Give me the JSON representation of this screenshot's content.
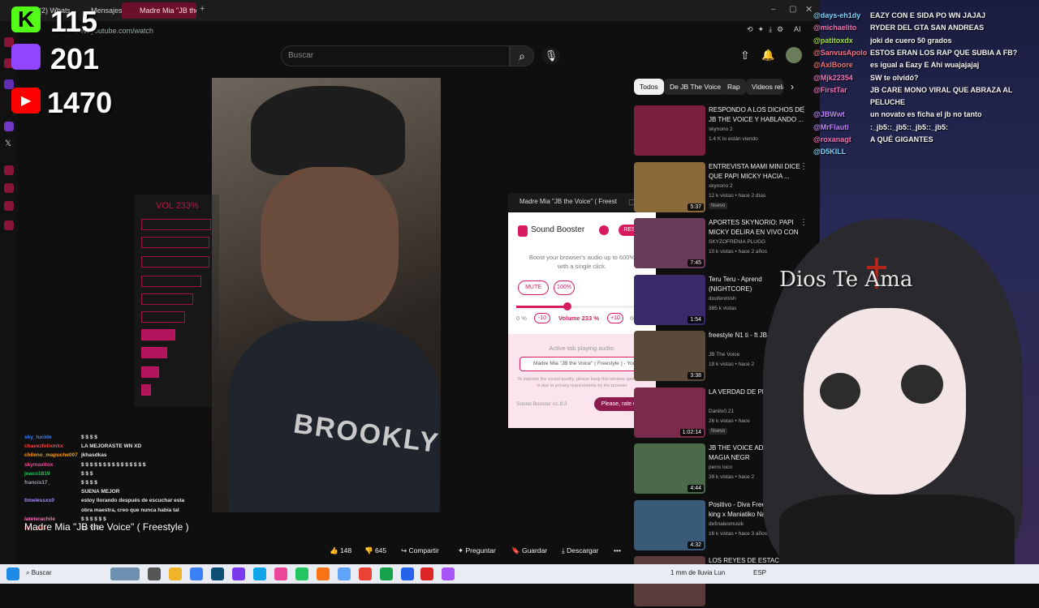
{
  "browser": {
    "tabs": [
      {
        "label": "(2) Whatsapp",
        "active": false
      },
      {
        "label": "Mensajes",
        "active": false
      },
      {
        "label": "Madre Mia \"JB the Voice\"",
        "active": true
      }
    ],
    "new_tab": "+",
    "url": "www.youtube.com/watch"
  },
  "overlay": {
    "kick_count": "115",
    "twitch_count": "201",
    "youtube_count": "1470",
    "volume_label": "VOL 233%",
    "volume_fraction": 0.4
  },
  "youtube": {
    "search_placeholder": "Buscar",
    "video_title": "Madre Mia \"JB the Voice\" ( Freestyle )",
    "video_shirt_text": "BROOKLY",
    "actions": {
      "likes": "148",
      "dislikes": "645",
      "share": "Compartir",
      "ask": "Preguntar",
      "save": "Guardar",
      "download": "Descargar"
    },
    "chips": [
      "Todos",
      "De JB The Voice",
      "Rap",
      "Videos rela"
    ],
    "recommendations": [
      {
        "title": "RESPONDO A LOS DICHOS DE JB THE VOICE Y HABLANDO ...",
        "channel": "skynorio 2",
        "meta": "1.4 K lo están viendo",
        "duration": "",
        "badge": "",
        "thumb": "#7a1f3d"
      },
      {
        "title": "ENTREVISTA MAMI MINI DICE QUE PAPI MICKY HACIA ...",
        "channel": "skynorio 2",
        "meta": "12 k vistas • hace 2 días",
        "duration": "5:37",
        "badge": "Nuevo",
        "thumb": "#8a6a3a"
      },
      {
        "title": "APORTES SKYNORIO: PAPI MICKY DELIRA EN VIVO CON",
        "channel": "SKYZOFRENIA PLUGG",
        "meta": "10 k vistas • hace 2 años",
        "duration": "7:45",
        "badge": "",
        "thumb": "#6a3a5a"
      },
      {
        "title": "Teru Teru - Aprend (NIGHTCORE)",
        "channel": "doofenmish",
        "meta": "385 k vistas",
        "duration": "1:54",
        "badge": "",
        "thumb": "#3a2a6a"
      },
      {
        "title": "freestyle N1 ti - ft JB the",
        "channel": "JB The Voice",
        "meta": "19 k vistas • hace 2",
        "duration": "3:38",
        "badge": "",
        "thumb": "#5a4a3a"
      },
      {
        "title": "LA VERDAD DE PLAYBOY",
        "channel": "Danilo0.21",
        "meta": "26 k vistas • hace",
        "duration": "1:02:14",
        "badge": "Nuevo",
        "thumb": "#7a2a4a"
      },
      {
        "title": "JB THE VOICE ADM HACIA MAGIA NEGR",
        "channel": "perro loco",
        "meta": "39 k vistas • hace 2",
        "duration": "4:44",
        "badge": "",
        "thumb": "#4a6a4a"
      },
      {
        "title": "Positivo - Diva Freestyle x Nachin king x Maniatiko Na",
        "channel": "definalesmusik",
        "meta": "16 k vistas • hace 3 años",
        "duration": "4:32",
        "badge": "",
        "thumb": "#3a5a7a"
      },
      {
        "title": "LOS REYES DE ESTACIÓN",
        "channel": "",
        "meta": "",
        "duration": "",
        "badge": "",
        "thumb": "#5a3a3a"
      }
    ]
  },
  "booster": {
    "window_title": "Madre Mia \"JB the Voice\" ( Freest",
    "title": "Sound Booster",
    "reset": "RESET",
    "description": "Boost your browser's audio up to 600% with a single click.",
    "mute": "MUTE",
    "preset": "100%",
    "min_label": "0 %",
    "minus": "-10",
    "volume_text": "Volume 233 %",
    "plus": "+10",
    "max_label": "600 %",
    "volume_fraction": 0.388,
    "active_label": "Active tab playing audio:",
    "active_tab": "Madre Mia \"JB the Voice\" ( Freestyle ) - YouT...",
    "note": "To improve the sound quality, please keep this window open. This is due to privacy requirements by the browser",
    "version": "Sound Booster v1.8.3",
    "rate": "Please, rate us!"
  },
  "chat_right": [
    {
      "user": "@days-eh1dy",
      "msg": "EAZY CON E SIDA PO WN JAJAJ",
      "ucolor": "#7dd3fc"
    },
    {
      "user": "@michaelito",
      "msg": "RYDER DEL GTA SAN ANDREAS",
      "ucolor": "#f472b6"
    },
    {
      "user": "@patitoxdx",
      "msg": "joki de cuero 50 grados",
      "ucolor": "#a3e635"
    },
    {
      "user": "@SanvusApolo",
      "msg": "ESTOS ERAN LOS RAP QUE SUBIA A FB?",
      "ucolor": "#fb7185"
    },
    {
      "user": "@AxlBoore",
      "msg": "es igual a Eazy E Ahi wuajajajaj",
      "ucolor": "#f87171"
    },
    {
      "user": "@Mjk22354",
      "msg": "SW te olvidó?",
      "ucolor": "#f472b6"
    },
    {
      "user": "@FirstTar",
      "msg": "JB CARE MONO VIRAL QUE ABRAZA AL",
      "ucolor": "#f472b6"
    },
    {
      "user": "",
      "msg": "PELUCHE",
      "ucolor": "#f472b6"
    },
    {
      "user": "@JBWwt",
      "msg": "un novato es ficha el jb no tanto",
      "ucolor": "#c084fc"
    },
    {
      "user": "@MrFlauti",
      "msg": ":_jb5::_jb5::_jb5::_jb5:",
      "ucolor": "#c084fc"
    },
    {
      "user": "@roxanagt",
      "msg": "A QUÉ GIGANTES",
      "ucolor": "#f472b6"
    },
    {
      "user": "@D5KILL",
      "msg": "",
      "ucolor": "#7dd3fc"
    }
  ],
  "chat_left": [
    {
      "user": "sky_tucide",
      "msg": "$ $ $ $",
      "ucolor": "#3b82f6"
    },
    {
      "user": "chavezfelixmkx",
      "msg": "LA MEJORASTE WN XD",
      "ucolor": "#ef4444"
    },
    {
      "user": "chileno_mapuche007",
      "msg": "jkhasdkas",
      "ucolor": "#f59e0b"
    },
    {
      "user": "skymaxitox",
      "msg": "$ $ $ $ $ $ $ $ $ $ $ $ $ $ $",
      "ucolor": "#ec4899"
    },
    {
      "user": "joaco1819",
      "msg": "$ $ $",
      "ucolor": "#22c55e"
    },
    {
      "user": "francis17_",
      "msg": "$ $ $ $",
      "ucolor": "#9ca3af"
    },
    {
      "user": "",
      "msg": "SUENA MEJOR",
      "ucolor": "#9ca3af"
    },
    {
      "user": "timelessxx0",
      "msg": "estoy llorando después de escuchar esta",
      "ucolor": "#a78bfa"
    },
    {
      "user": "",
      "msg": "obra maestra, creo que nunca había tal",
      "ucolor": "#a78bfa"
    },
    {
      "user": "lateterachile",
      "msg": "$ $ $ $ $ $",
      "ucolor": "#f472b6"
    },
    {
      "user": "sky_zeta",
      "msg": "SE YSO",
      "ucolor": "#ef4444"
    }
  ],
  "avatar": {
    "caption": "Dios Te Ama"
  },
  "taskbar": {
    "search": "Buscar",
    "weather": "1 mm de lluvia Lun",
    "lang": "ESP"
  }
}
